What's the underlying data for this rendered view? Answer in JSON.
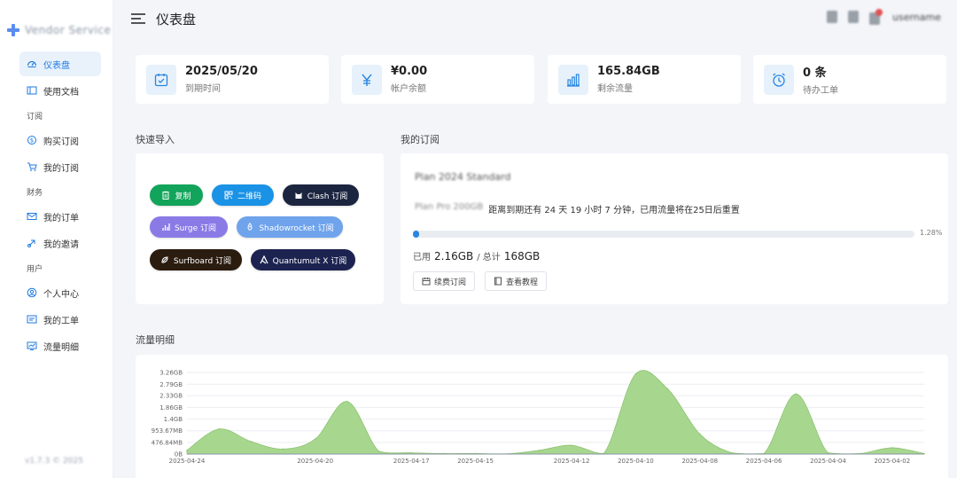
{
  "sidebar": {
    "brand": "Vendor Service",
    "items": [
      {
        "label": "仪表盘",
        "icon": "dashboard-icon",
        "active": true
      },
      {
        "label": "使用文档",
        "icon": "book-icon"
      }
    ],
    "groups": [
      {
        "title": "订阅",
        "items": [
          {
            "label": "购买订阅",
            "icon": "coin-icon"
          },
          {
            "label": "我的订阅",
            "icon": "cart-icon"
          }
        ]
      },
      {
        "title": "财务",
        "items": [
          {
            "label": "我的订单",
            "icon": "order-icon"
          },
          {
            "label": "我的邀请",
            "icon": "invite-icon"
          }
        ]
      },
      {
        "title": "用户",
        "items": [
          {
            "label": "个人中心",
            "icon": "user-icon"
          },
          {
            "label": "我的工单",
            "icon": "ticket-icon"
          },
          {
            "label": "流量明细",
            "icon": "traffic-icon"
          }
        ]
      }
    ],
    "footer": "v1.7.3 © 2025"
  },
  "header": {
    "title": "仪表盘",
    "user": "username"
  },
  "stats": [
    {
      "value": "2025/05/20",
      "label": "到期时间",
      "icon": "calendar-check-icon"
    },
    {
      "value": "¥0.00",
      "label": "帐户余额",
      "icon": "yen-icon"
    },
    {
      "value": "165.84GB",
      "label": "剩余流量",
      "icon": "bar-chart-icon"
    },
    {
      "value": "0 条",
      "label": "待办工单",
      "icon": "alarm-clock-icon"
    }
  ],
  "quick_import": {
    "title": "快速导入",
    "buttons": [
      {
        "label": "复制",
        "color": "#12a45a",
        "icon": "clipboard-icon"
      },
      {
        "label": "二维码",
        "color": "#1a92e6",
        "icon": "qrcode-icon"
      },
      {
        "label": "Clash 订阅",
        "color": "#1c2540",
        "icon": "cat-icon"
      },
      {
        "label": "Surge 订阅",
        "color": "#8a7ae6",
        "icon": "surge-icon"
      },
      {
        "label": "Shadowrocket 订阅",
        "color": "#6fa3ec",
        "icon": "rocket-icon"
      },
      {
        "label": "Surfboard 订阅",
        "color": "#2b1c10",
        "icon": "surfboard-icon"
      },
      {
        "label": "Quantumult X 订阅",
        "color": "#1c2350",
        "icon": "quantumult-icon"
      }
    ]
  },
  "subscription": {
    "title": "我的订阅",
    "plan_name": "Plan 2024 Standard",
    "plan_blur": "Plan Pro 200GB",
    "expire_text": "距离到期还有 24 天 19 小时 7 分钟，已用流量将在25日后重置",
    "progress": 1.28,
    "progress_label": "1.28%",
    "used_prefix": "已用",
    "used": "2.16GB",
    "total_sep": "/ 总计",
    "total": "168GB",
    "renew_label": "续费订阅",
    "tutorial_label": "查看教程"
  },
  "traffic": {
    "title": "流量明细"
  },
  "chart_data": {
    "type": "area",
    "x": [
      "2025-04-24",
      "2025-04-23",
      "2025-04-22",
      "2025-04-21",
      "2025-04-20",
      "2025-04-19",
      "2025-04-18",
      "2025-04-17",
      "2025-04-16",
      "2025-04-15",
      "2025-04-14",
      "2025-04-13",
      "2025-04-12",
      "2025-04-11",
      "2025-04-10",
      "2025-04-09",
      "2025-04-08",
      "2025-04-07",
      "2025-04-06",
      "2025-04-05",
      "2025-04-04",
      "2025-04-03",
      "2025-04-02",
      "2025-04-01"
    ],
    "y_gb": [
      0.15,
      1.0,
      0.5,
      0.2,
      0.6,
      2.1,
      0.1,
      0.05,
      0.02,
      0.02,
      0.01,
      0.15,
      0.35,
      0.02,
      3.2,
      2.6,
      0.8,
      0.05,
      0.02,
      2.4,
      0.05,
      0.02,
      0.25,
      0.02
    ],
    "ylabels": [
      "0B",
      "476.84MB",
      "953.67MB",
      "1.4GB",
      "1.86GB",
      "2.33GB",
      "2.79GB",
      "3.26GB"
    ],
    "ylabel_values_gb": [
      0,
      0.4657,
      0.9313,
      1.4,
      1.86,
      2.33,
      2.79,
      3.26
    ],
    "xlabels": [
      "2025-04-24",
      "2025-04-20",
      "2025-04-17",
      "2025-04-15",
      "2025-04-12",
      "2025-04-10",
      "2025-04-08",
      "2025-04-06",
      "2025-04-04",
      "2025-04-02"
    ],
    "ylim": [
      0,
      3.26
    ],
    "color": "#a7d78f"
  }
}
